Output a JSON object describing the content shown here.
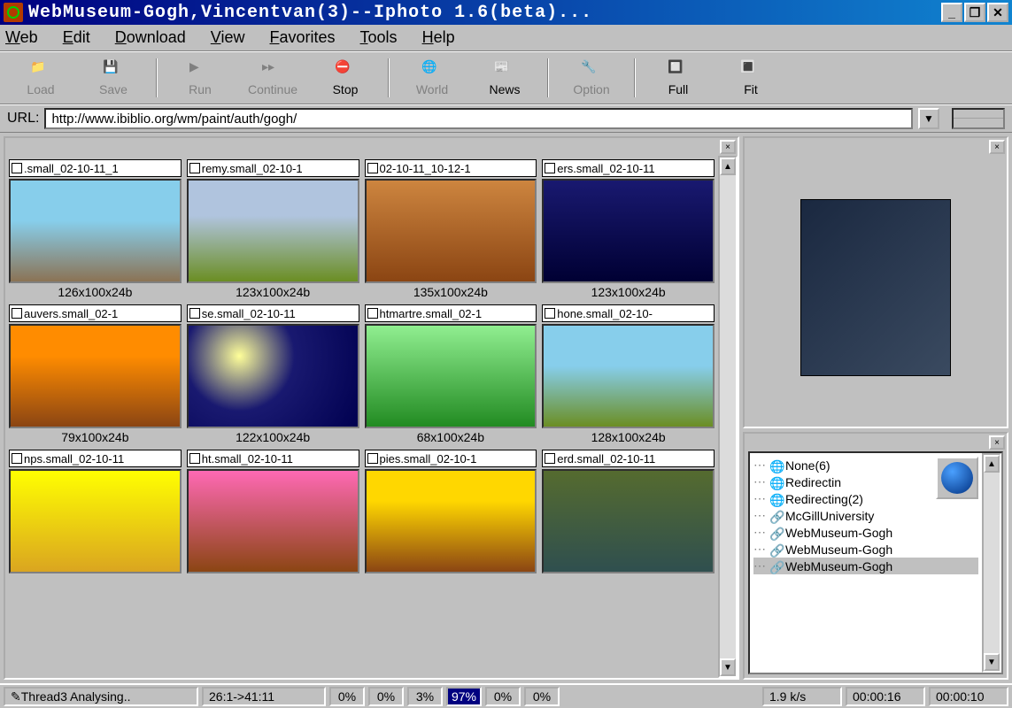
{
  "window": {
    "title": "WebMuseum-Gogh,Vincentvan(3)--Iphoto 1.6(beta)..."
  },
  "menu": [
    "Web",
    "Edit",
    "Download",
    "View",
    "Favorites",
    "Tools",
    "Help"
  ],
  "toolbar": {
    "load": "Load",
    "save": "Save",
    "run": "Run",
    "continue": "Continue",
    "stop": "Stop",
    "world": "World",
    "news": "News",
    "option": "Option",
    "full": "Full",
    "fit": "Fit"
  },
  "url": {
    "label": "URL:",
    "value": "http://www.ibiblio.org/wm/paint/auth/gogh/"
  },
  "thumbs": [
    {
      "name": ".small_02-10-11_1",
      "dim": "126x100x24b"
    },
    {
      "name": "remy.small_02-10-1",
      "dim": "123x100x24b"
    },
    {
      "name": "02-10-11_10-12-1",
      "dim": "135x100x24b"
    },
    {
      "name": "ers.small_02-10-11",
      "dim": "123x100x24b"
    },
    {
      "name": "auvers.small_02-1",
      "dim": "79x100x24b"
    },
    {
      "name": "se.small_02-10-11",
      "dim": "122x100x24b"
    },
    {
      "name": "htmartre.small_02-1",
      "dim": "68x100x24b"
    },
    {
      "name": "hone.small_02-10-",
      "dim": "128x100x24b"
    },
    {
      "name": "nps.small_02-10-11",
      "dim": ""
    },
    {
      "name": "ht.small_02-10-11",
      "dim": ""
    },
    {
      "name": "pies.small_02-10-1",
      "dim": ""
    },
    {
      "name": "erd.small_02-10-11",
      "dim": ""
    }
  ],
  "tree": [
    {
      "label": "None(6)",
      "icon": "globe"
    },
    {
      "label": "Redirectin",
      "icon": "globe"
    },
    {
      "label": "Redirecting(2)",
      "icon": "globe"
    },
    {
      "label": "McGillUniversity",
      "icon": "link"
    },
    {
      "label": "WebMuseum-Gogh",
      "icon": "link"
    },
    {
      "label": "WebMuseum-Gogh",
      "icon": "link"
    },
    {
      "label": "WebMuseum-Gogh",
      "icon": "link",
      "selected": true
    }
  ],
  "status": {
    "thread": "Thread3 Analysing..",
    "progress": "26:1->41:11",
    "pcts": [
      "0%",
      "0%",
      "3%",
      "97%",
      "0%",
      "0%"
    ],
    "speed": "1.9 k/s",
    "t1": "00:00:16",
    "t2": "00:00:10"
  }
}
